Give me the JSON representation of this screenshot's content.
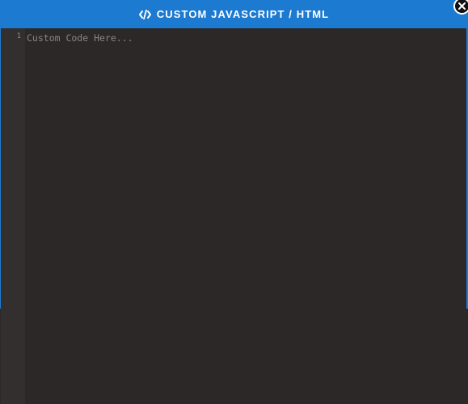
{
  "modal": {
    "title": "CUSTOM JAVASCRIPT / HTML",
    "title_icon": "code-icon",
    "close_icon": "close-icon",
    "accent_color": "#1d7ad1"
  },
  "editor": {
    "line_numbers": [
      "1"
    ],
    "placeholder": "Custom Code Here...",
    "background_color": "#2d2828"
  }
}
